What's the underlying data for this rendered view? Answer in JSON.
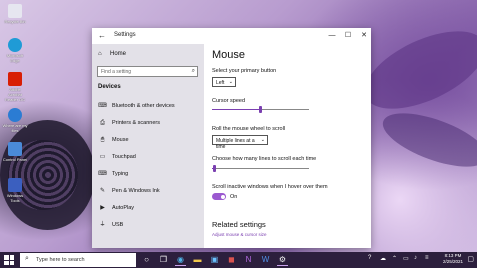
{
  "desktop": {
    "icons": [
      {
        "label": "Recycle Bin",
        "color": "#e6e6f0"
      },
      {
        "label": "Microsoft Edge",
        "color": "#1f9bd6"
      },
      {
        "label": "Adobe Acrobat Reader DC",
        "color": "#d81e05"
      },
      {
        "label": "Where are my files",
        "color": "#2b7cd3"
      },
      {
        "label": "Control Panel",
        "color": "#4a8ad8"
      },
      {
        "label": "Windows Tools",
        "color": "#3b5fbf"
      }
    ]
  },
  "window": {
    "title": "Settings",
    "back_icon": "←",
    "minimize": "—",
    "maximize": "☐",
    "close": "✕"
  },
  "nav": {
    "home": "Home",
    "search_placeholder": "Find a setting",
    "section": "Devices",
    "items": [
      {
        "label": "Bluetooth & other devices",
        "icon": "⌨"
      },
      {
        "label": "Printers & scanners",
        "icon": "⎙"
      },
      {
        "label": "Mouse",
        "icon": "🖱"
      },
      {
        "label": "Touchpad",
        "icon": "▭"
      },
      {
        "label": "Typing",
        "icon": "⌨"
      },
      {
        "label": "Pen & Windows Ink",
        "icon": "✎"
      },
      {
        "label": "AutoPlay",
        "icon": "▶"
      },
      {
        "label": "USB",
        "icon": "⏚"
      }
    ]
  },
  "mouse": {
    "title": "Mouse",
    "primary_button_label": "Select your primary button",
    "primary_button_value": "Left",
    "cursor_speed_label": "Cursor speed",
    "cursor_speed": 0.5,
    "wheel_label": "Roll the mouse wheel to scroll",
    "wheel_value": "Multiple lines at a time",
    "lines_label": "Choose how many lines to scroll each time",
    "lines_value": 0.03,
    "inactive_label": "Scroll inactive windows when I hover over them",
    "inactive_toggle": "On",
    "related_title": "Related settings",
    "related_link": "Adjust mouse & cursor size"
  },
  "taskbar": {
    "search_placeholder": "Type here to search",
    "clock_time": "8:13 PM",
    "clock_date": "2/25/2021",
    "accent": "#9b59d0"
  }
}
